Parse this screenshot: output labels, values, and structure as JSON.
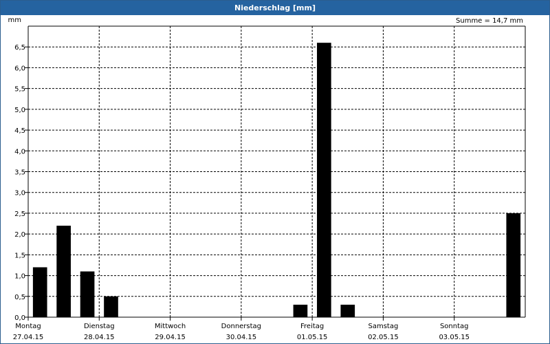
{
  "window": {
    "title": "Niederschlag [mm]"
  },
  "chart_data": {
    "type": "bar",
    "title": "Niederschlag [mm]",
    "ylabel": "mm",
    "ylim": [
      0,
      7.0
    ],
    "yticks": [
      "0,0",
      "0,5",
      "1,0",
      "1,5",
      "2,0",
      "2,5",
      "3,0",
      "3,5",
      "4,0",
      "4,5",
      "5,0",
      "5,5",
      "6,0",
      "6,5"
    ],
    "annotation": "Summe = 14,7 mm",
    "grid": true,
    "days": [
      {
        "day": "Montag",
        "date": "27.04.15"
      },
      {
        "day": "Dienstag",
        "date": "28.04.15"
      },
      {
        "day": "Mittwoch",
        "date": "29.04.15"
      },
      {
        "day": "Donnerstag",
        "date": "30.04.15"
      },
      {
        "day": "Freitag",
        "date": "01.05.15"
      },
      {
        "day": "Samstag",
        "date": "02.05.15"
      },
      {
        "day": "Sonntag",
        "date": "03.05.15"
      }
    ],
    "bar_interval_hours": 8,
    "values": [
      1.2,
      2.2,
      1.1,
      0.5,
      0,
      0,
      0,
      0,
      0,
      0,
      0,
      0.3,
      6.6,
      0.3,
      0,
      0,
      0,
      0,
      0,
      0,
      2.5
    ],
    "bar_color": "#000000"
  }
}
